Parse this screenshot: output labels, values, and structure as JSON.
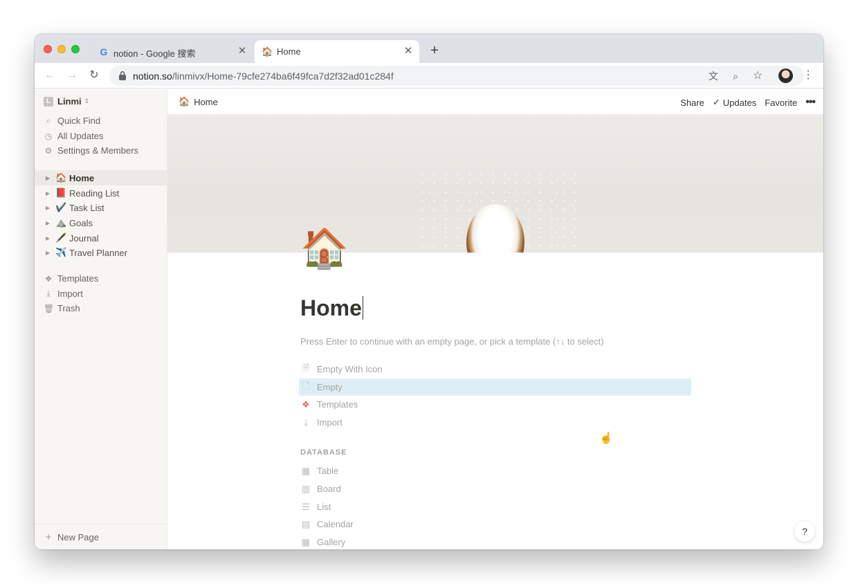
{
  "browser": {
    "tabs": [
      {
        "title": "notion - Google 搜索",
        "icon": "google-g-icon",
        "icon_glyph": "G"
      },
      {
        "title": "Home",
        "icon": "house-emoji",
        "icon_glyph": "🏠"
      }
    ],
    "new_tab_glyph": "+",
    "close_glyph": "✕",
    "url_host": "notion.so",
    "url_path": "/linmivx/Home-79cfe274ba6f49fca7d2f32ad01c284f"
  },
  "sidebar": {
    "workspace_name": "Linmi",
    "workspace_initial": "L",
    "workspace_chevron": "⇕",
    "utilities": [
      {
        "label": "Quick Find",
        "icon": "search-icon",
        "glyph": "⌕"
      },
      {
        "label": "All Updates",
        "icon": "clock-icon",
        "glyph": "◷"
      },
      {
        "label": "Settings & Members",
        "icon": "gear-icon",
        "glyph": "⚙"
      }
    ],
    "pages": [
      {
        "label": "Home",
        "emoji": "🏠",
        "selected": true
      },
      {
        "label": "Reading List",
        "emoji": "📕",
        "selected": false
      },
      {
        "label": "Task List",
        "emoji": "✔️",
        "selected": false
      },
      {
        "label": "Goals",
        "emoji": "⛰️",
        "selected": false
      },
      {
        "label": "Journal",
        "emoji": "🖋️",
        "selected": false
      },
      {
        "label": "Travel Planner",
        "emoji": "✈️",
        "selected": false
      }
    ],
    "tools": [
      {
        "label": "Templates",
        "icon": "templates-icon",
        "glyph": "❖"
      },
      {
        "label": "Import",
        "icon": "import-icon",
        "glyph": "⤓"
      },
      {
        "label": "Trash",
        "icon": "trash-icon",
        "glyph": "🗑"
      }
    ],
    "new_page_label": "New Page",
    "new_page_glyph": "+"
  },
  "topbar": {
    "breadcrumb_emoji": "🏠",
    "breadcrumb_label": "Home",
    "share_label": "Share",
    "updates_label": "Updates",
    "favorite_label": "Favorite",
    "more_glyph": "•••"
  },
  "page": {
    "icon": "🏠",
    "title": "Home",
    "hint": "Press Enter to continue with an empty page, or pick a template (↑↓ to select)",
    "templates": [
      {
        "label": "Empty With Icon",
        "icon": "page-lines-icon",
        "glyph": "🗎",
        "selected": false
      },
      {
        "label": "Empty",
        "icon": "blank-page-icon",
        "glyph": "🗋",
        "selected": true
      },
      {
        "label": "Templates",
        "icon": "shapes-icon",
        "glyph": "❖",
        "selected": false
      },
      {
        "label": "Import",
        "icon": "download-icon",
        "glyph": "⤓",
        "selected": false
      }
    ],
    "database_label": "DATABASE",
    "database_items": [
      {
        "label": "Table",
        "icon": "table-icon",
        "glyph": "▦"
      },
      {
        "label": "Board",
        "icon": "board-icon",
        "glyph": "▥"
      },
      {
        "label": "List",
        "icon": "list-icon",
        "glyph": "☰"
      },
      {
        "label": "Calendar",
        "icon": "calendar-icon",
        "glyph": "▤"
      },
      {
        "label": "Gallery",
        "icon": "gallery-icon",
        "glyph": "▦"
      }
    ],
    "help_glyph": "?"
  },
  "colors": {
    "sidebar_bg": "#f7f6f3",
    "selected_template_bg": "#ddeff5",
    "text": "#37352f",
    "muted_text": "#a5a49f"
  }
}
